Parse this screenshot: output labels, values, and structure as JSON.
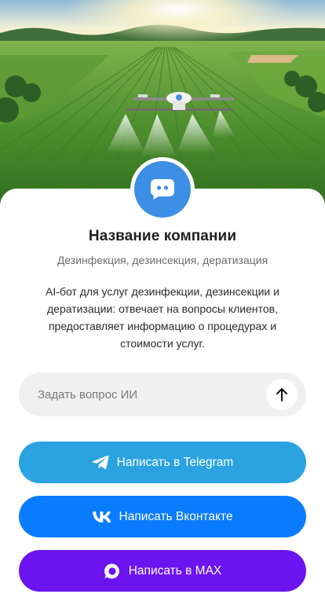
{
  "hero": {
    "image": "drone-spraying-crop-field"
  },
  "profile": {
    "avatar_icon": "chat-bot-icon",
    "name": "Название компании",
    "tagline": "Дезинфекция, дезинсекция, дератизация",
    "description": "AI-бот для услуг дезинфекции, дезинсекции и дератизации: отвечает на вопросы клиентов, предоставляет информацию о процедурах и стоимости услуг."
  },
  "ask": {
    "placeholder": "Задать вопрос ИИ",
    "send_icon": "arrow-up-icon"
  },
  "actions": {
    "telegram": {
      "label": "Написать в Telegram",
      "icon": "telegram-icon",
      "color": "#2aa3e0"
    },
    "vk": {
      "label": "Написать Вконтакте",
      "icon": "vk-icon",
      "color": "#0a7cff"
    },
    "max": {
      "label": "Написать в MAX",
      "icon": "max-icon",
      "color": "#6c14f0"
    }
  },
  "colors": {
    "avatar": "#3d8fe6",
    "input_bg": "#f0f0f0"
  }
}
